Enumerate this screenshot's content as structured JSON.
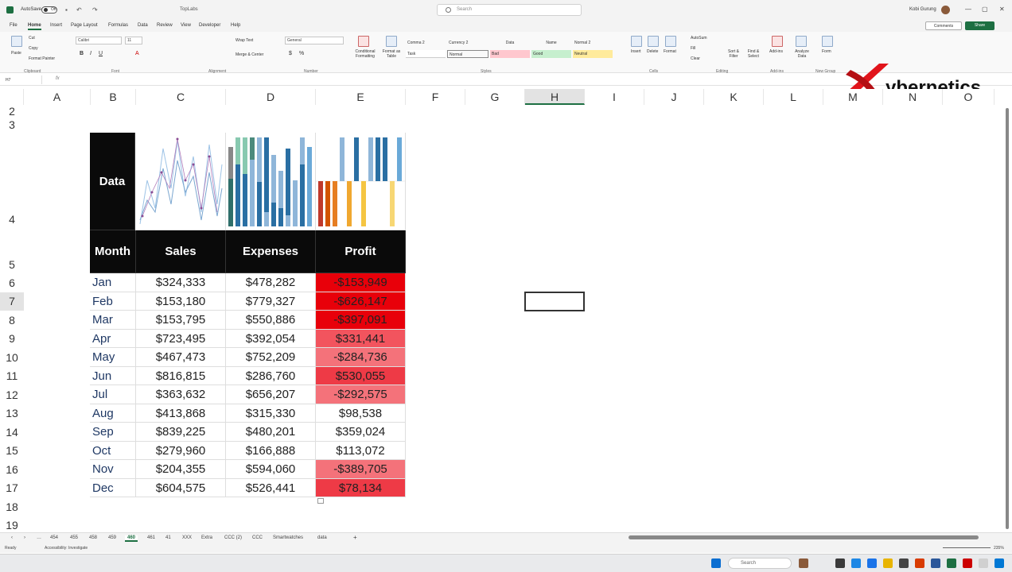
{
  "titlebar": {
    "autosave": "AutoSave",
    "autosave_state": "Off",
    "filename": "TopLabs",
    "search_placeholder": "Search",
    "user": "Kobi Gurung"
  },
  "menu_tabs": [
    "File",
    "Home",
    "Insert",
    "Page Layout",
    "Formulas",
    "Data",
    "Review",
    "View",
    "Developer",
    "Help"
  ],
  "active_tab": "Home",
  "buttons": {
    "comments": "Comments",
    "share": "Share"
  },
  "ribbon": {
    "clipboard": {
      "paste": "Paste",
      "cut": "Cut",
      "copy": "Copy",
      "painter": "Format Painter",
      "label": "Clipboard"
    },
    "font": {
      "name": "Calibri",
      "size": "11",
      "label": "Font"
    },
    "alignment": {
      "wrap": "Wrap Text",
      "merge": "Merge & Center",
      "label": "Alignment"
    },
    "number": {
      "format": "General",
      "label": "Number"
    },
    "styles": {
      "cond": "Conditional Formatting",
      "table": "Format as Table",
      "label": "Styles",
      "cells": [
        {
          "text": "Comma 2",
          "bg": "#ffffff"
        },
        {
          "text": "Currency 2",
          "bg": "#ffffff"
        },
        {
          "text": "Data",
          "bg": "#ffffff"
        },
        {
          "text": "Name",
          "bg": "#ffffff"
        },
        {
          "text": "Normal 2",
          "bg": "#ffffff"
        },
        {
          "text": "Task",
          "bg": "#ffffff"
        },
        {
          "text": "Normal",
          "bg": "#ffffff"
        },
        {
          "text": "Bad",
          "bg": "#ffc7ce"
        },
        {
          "text": "Good",
          "bg": "#c6efce"
        },
        {
          "text": "Neutral",
          "bg": "#ffeb9c"
        }
      ]
    },
    "cells": {
      "insert": "Insert",
      "delete": "Delete",
      "format": "Format",
      "label": "Cells"
    },
    "editing": {
      "autosum": "AutoSum",
      "fill": "Fill",
      "clear": "Clear",
      "sort": "Sort & Filter",
      "find": "Find & Select",
      "label": "Editing"
    },
    "addins": {
      "addins": "Add-ins",
      "analyze": "Analyze Data",
      "label": "Add-ins"
    },
    "newgroup": {
      "form": "Form",
      "label": "New Group"
    }
  },
  "formula_bar": {
    "name_box": "H7",
    "fx": "fx"
  },
  "columns": [
    "A",
    "B",
    "C",
    "D",
    "E",
    "F",
    "G",
    "H",
    "I",
    "J",
    "K",
    "L",
    "M",
    "N",
    "O"
  ],
  "selected_column": "H",
  "rows": [
    "2",
    "3",
    "4",
    "5",
    "6",
    "7",
    "8",
    "9",
    "10",
    "11",
    "12",
    "13",
    "14",
    "15",
    "16",
    "17",
    "18",
    "19"
  ],
  "selected_row": "7",
  "data_label": "Data",
  "table": {
    "headers": [
      "Month",
      "Sales",
      "Expenses",
      "Profit"
    ],
    "rows": [
      {
        "month": "Jan",
        "sales": "$324,333",
        "expenses": "$478,282",
        "profit": "-$153,949",
        "fill": "#e8000a"
      },
      {
        "month": "Feb",
        "sales": "$153,180",
        "expenses": "$779,327",
        "profit": "-$626,147",
        "fill": "#e8000a"
      },
      {
        "month": "Mar",
        "sales": "$153,795",
        "expenses": "$550,886",
        "profit": "-$397,091",
        "fill": "#e8000a"
      },
      {
        "month": "Apr",
        "sales": "$723,495",
        "expenses": "$392,054",
        "profit": "$331,441",
        "fill": "#f2545e"
      },
      {
        "month": "May",
        "sales": "$467,473",
        "expenses": "$752,209",
        "profit": "-$284,736",
        "fill": "#f4727a"
      },
      {
        "month": "Jun",
        "sales": "$816,815",
        "expenses": "$286,760",
        "profit": "$530,055",
        "fill": "#ee3a46"
      },
      {
        "month": "Jul",
        "sales": "$363,632",
        "expenses": "$656,207",
        "profit": "-$292,575",
        "fill": "#f4727a"
      },
      {
        "month": "Aug",
        "sales": "$413,868",
        "expenses": "$315,330",
        "profit": "$98,538",
        "fill": "#ffffff"
      },
      {
        "month": "Sep",
        "sales": "$839,225",
        "expenses": "$480,201",
        "profit": "$359,024",
        "fill": "#ffffff"
      },
      {
        "month": "Oct",
        "sales": "$279,960",
        "expenses": "$166,888",
        "profit": "$113,072",
        "fill": "#ffffff"
      },
      {
        "month": "Nov",
        "sales": "$204,355",
        "expenses": "$594,060",
        "profit": "-$389,705",
        "fill": "#f4727a"
      },
      {
        "month": "Dec",
        "sales": "$604,575",
        "expenses": "$526,441",
        "profit": "$78,134",
        "fill": "#ee3a46"
      }
    ]
  },
  "sheet_tabs": [
    "454",
    "455",
    "458",
    "459",
    "460",
    "461",
    "41",
    "XXX",
    "Extra",
    "CCC (2)",
    "CCC",
    "Smartwatches",
    "data"
  ],
  "active_sheet": "460",
  "status": {
    "ready": "Ready",
    "accessibility": "Accessibility: Investigate",
    "zoom": "235%"
  },
  "taskbar": {
    "search": "Search"
  },
  "logo": {
    "text": "ybernetics"
  },
  "colors": {
    "excel_green": "#1d6f42",
    "header_black": "#0a0a0a"
  }
}
